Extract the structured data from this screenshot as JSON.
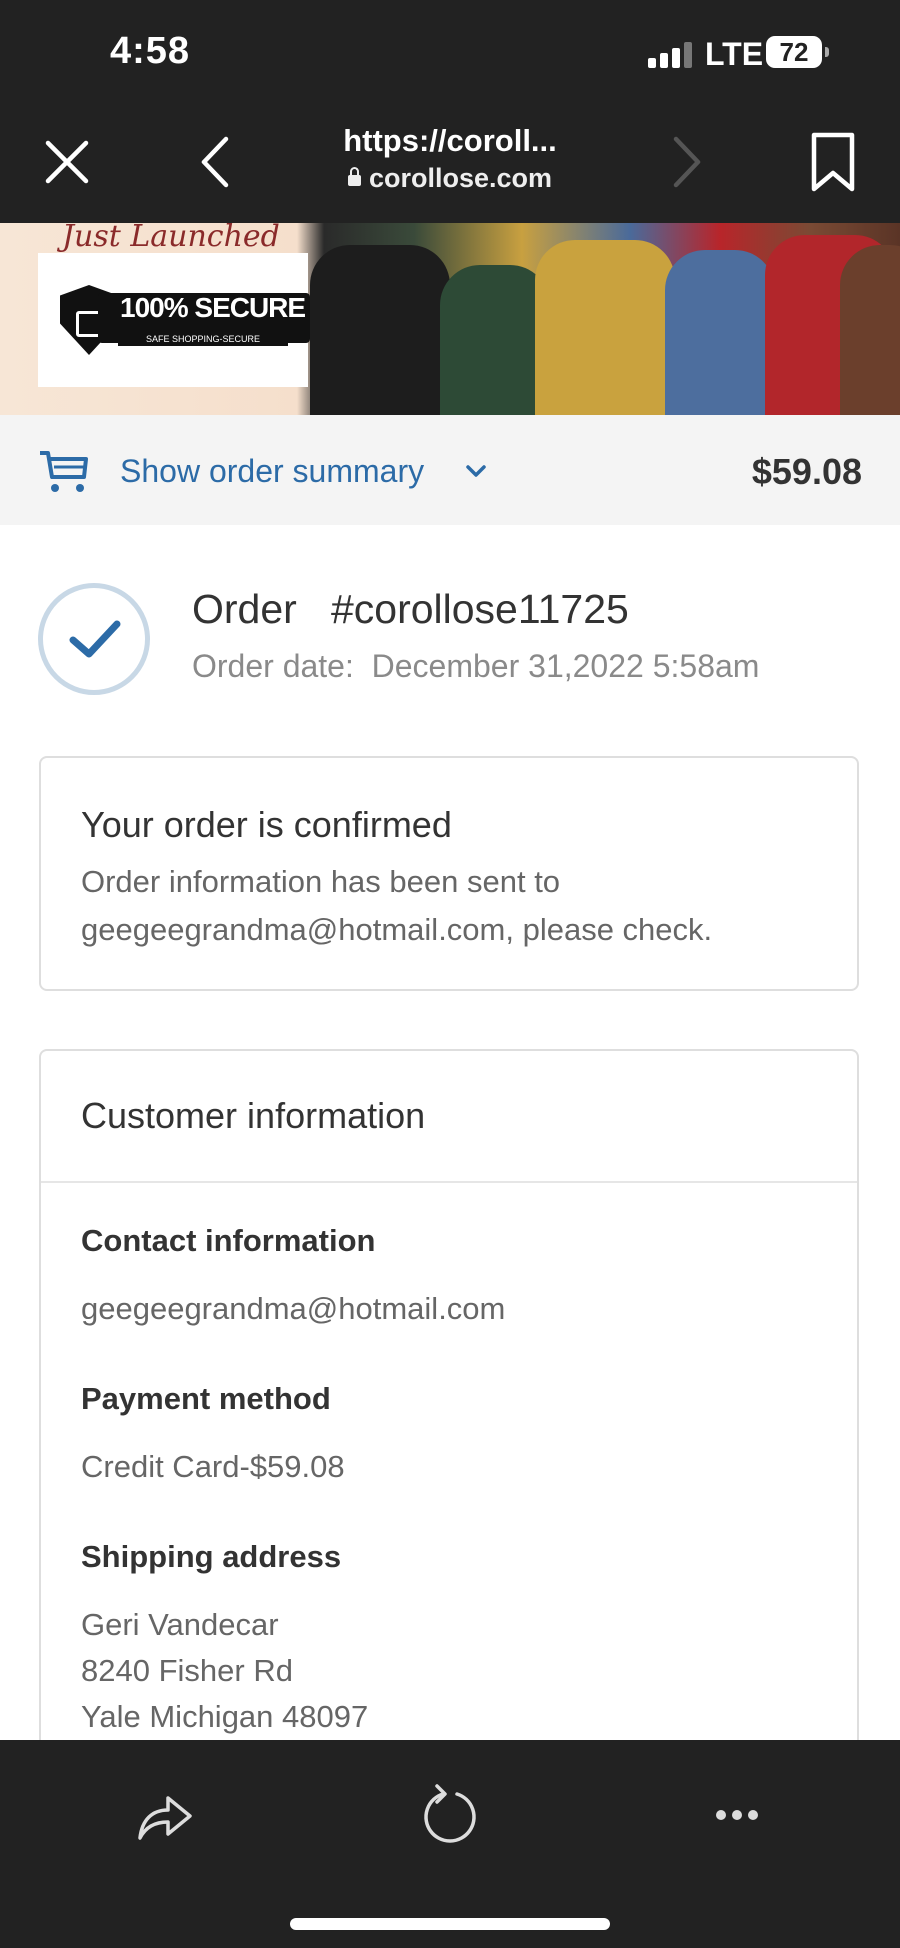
{
  "status_bar": {
    "time": "4:58",
    "network": "LTE",
    "battery": "72"
  },
  "browser": {
    "title": "https://coroll...",
    "domain": "corollose.com"
  },
  "banner": {
    "script_text": "Just Launched",
    "secure_badge": "100% SECURE",
    "secure_sub": "SAFE SHOPPING-SECURE CHECKOUTS"
  },
  "order_summary": {
    "toggle_label": "Show order summary",
    "total": "$59.08"
  },
  "order": {
    "title": "Order   #corollose11725",
    "date": "Order date:  December 31,2022 5:58am"
  },
  "confirmation": {
    "title": "Your order is confirmed",
    "line1": "Order information has been sent to",
    "line2": "geegeegrandma@hotmail.com, please check."
  },
  "customer_info": {
    "title": "Customer information",
    "contact_label": "Contact information",
    "contact_value": "geegeegrandma@hotmail.com",
    "payment_label": "Payment method",
    "payment_value": "Credit Card-$59.08",
    "shipping_label": "Shipping address",
    "address_name": "Geri Vandecar",
    "address_street": "8240 Fisher Rd",
    "address_city": "Yale Michigan 48097"
  },
  "colors": {
    "link": "#2c6ba7",
    "check": "#2c6ba7",
    "chrome": "#222222"
  }
}
